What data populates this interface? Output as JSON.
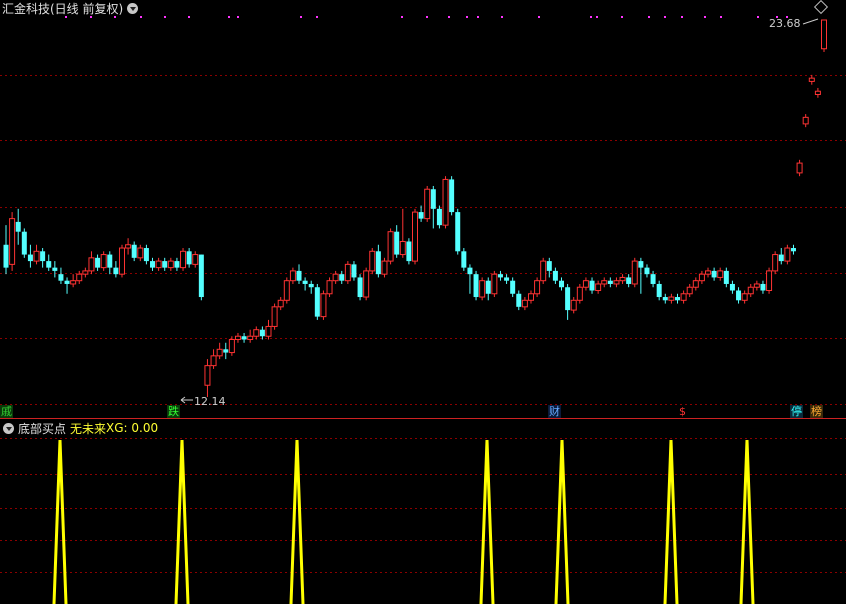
{
  "header": {
    "title": "汇金科技(日线 前复权)"
  },
  "price_labels": {
    "high": "23.68",
    "low": "12.14"
  },
  "markers": [
    {
      "text": "戚",
      "color": "#33cc33",
      "bg": "#0a3a0a"
    },
    {
      "text": "跌",
      "color": "#33ff33",
      "bg": "#0a3a0a"
    },
    {
      "text": "财",
      "color": "#66aaff",
      "bg": "#0a1a3a"
    },
    {
      "text": "$",
      "color": "#ff3333",
      "bg": "transparent"
    },
    {
      "text": "停",
      "color": "#33ffff",
      "bg": "#0a2a3a"
    },
    {
      "text": "榜",
      "color": "#ffaa33",
      "bg": "#3a2a0a"
    }
  ],
  "indicator": {
    "name": "底部买点",
    "param1": "无未来",
    "param2": "XG: 0.00"
  },
  "colors": {
    "up": "#ff3333",
    "down": "#54ffff",
    "grid": "#8b0000",
    "signal": "#ffff00",
    "dots": "#ff33ff"
  },
  "chart_data": {
    "type": "candlestick",
    "symbol": "汇金科技",
    "period": "日线 前复权",
    "ylim": [
      12.14,
      23.68
    ],
    "candles": [
      [
        16.8,
        16.1,
        17.4,
        15.9
      ],
      [
        16.2,
        17.6,
        17.8,
        16.0
      ],
      [
        17.5,
        17.2,
        17.9,
        16.8
      ],
      [
        17.2,
        16.5,
        17.3,
        16.4
      ],
      [
        16.5,
        16.3,
        16.8,
        16.1
      ],
      [
        16.3,
        16.6,
        16.8,
        16.2
      ],
      [
        16.6,
        16.3,
        16.7,
        16.1
      ],
      [
        16.3,
        16.1,
        16.5,
        16.0
      ],
      [
        16.1,
        16.0,
        16.3,
        15.8
      ],
      [
        15.9,
        15.7,
        16.1,
        15.6
      ],
      [
        15.7,
        15.6,
        15.8,
        15.3
      ],
      [
        15.6,
        15.7,
        15.9,
        15.5
      ],
      [
        15.7,
        15.9,
        16.0,
        15.6
      ],
      [
        15.9,
        16.0,
        16.1,
        15.8
      ],
      [
        16.0,
        16.4,
        16.6,
        15.9
      ],
      [
        16.4,
        16.1,
        16.5,
        16.0
      ],
      [
        16.1,
        16.5,
        16.6,
        16.0
      ],
      [
        16.5,
        16.1,
        16.6,
        15.9
      ],
      [
        16.1,
        15.9,
        16.3,
        15.8
      ],
      [
        15.9,
        16.7,
        16.8,
        15.8
      ],
      [
        16.7,
        16.8,
        17.0,
        16.5
      ],
      [
        16.8,
        16.4,
        16.9,
        16.3
      ],
      [
        16.4,
        16.7,
        16.8,
        16.3
      ],
      [
        16.7,
        16.3,
        16.8,
        16.2
      ],
      [
        16.3,
        16.1,
        16.4,
        16.0
      ],
      [
        16.1,
        16.3,
        16.4,
        16.0
      ],
      [
        16.3,
        16.1,
        16.4,
        16.0
      ],
      [
        16.1,
        16.3,
        16.4,
        16.0
      ],
      [
        16.3,
        16.1,
        16.4,
        16.0
      ],
      [
        16.1,
        16.6,
        16.7,
        16.0
      ],
      [
        16.6,
        16.2,
        16.7,
        16.1
      ],
      [
        16.2,
        16.5,
        16.6,
        16.1
      ],
      [
        16.5,
        15.2,
        16.5,
        15.1
      ],
      [
        12.5,
        13.1,
        13.3,
        12.14
      ],
      [
        13.1,
        13.4,
        13.6,
        13.0
      ],
      [
        13.4,
        13.6,
        13.8,
        13.3
      ],
      [
        13.6,
        13.5,
        13.8,
        13.3
      ],
      [
        13.5,
        13.9,
        14.0,
        13.4
      ],
      [
        13.9,
        14.0,
        14.1,
        13.8
      ],
      [
        14.0,
        13.9,
        14.1,
        13.8
      ],
      [
        13.9,
        14.0,
        14.2,
        13.8
      ],
      [
        14.0,
        14.2,
        14.3,
        13.9
      ],
      [
        14.2,
        14.0,
        14.3,
        13.9
      ],
      [
        14.0,
        14.3,
        14.5,
        13.9
      ],
      [
        14.3,
        14.9,
        15.0,
        14.2
      ],
      [
        14.9,
        15.1,
        15.2,
        14.8
      ],
      [
        15.1,
        15.7,
        15.8,
        15.0
      ],
      [
        15.7,
        16.0,
        16.1,
        15.6
      ],
      [
        16.0,
        15.7,
        16.2,
        15.6
      ],
      [
        15.7,
        15.6,
        15.8,
        15.4
      ],
      [
        15.6,
        15.5,
        15.7,
        15.3
      ],
      [
        15.5,
        14.6,
        15.6,
        14.5
      ],
      [
        14.6,
        15.3,
        15.4,
        14.5
      ],
      [
        15.3,
        15.7,
        15.8,
        15.2
      ],
      [
        15.7,
        15.9,
        16.0,
        15.6
      ],
      [
        15.9,
        15.7,
        16.0,
        15.6
      ],
      [
        15.7,
        16.2,
        16.3,
        15.6
      ],
      [
        16.2,
        15.8,
        16.3,
        15.7
      ],
      [
        15.8,
        15.2,
        15.9,
        15.1
      ],
      [
        15.2,
        16.0,
        16.1,
        15.1
      ],
      [
        16.0,
        16.6,
        16.7,
        15.9
      ],
      [
        16.6,
        15.9,
        16.8,
        15.8
      ],
      [
        15.9,
        16.3,
        16.4,
        15.8
      ],
      [
        16.3,
        17.2,
        17.3,
        16.2
      ],
      [
        17.2,
        16.5,
        17.4,
        16.4
      ],
      [
        16.5,
        16.9,
        17.9,
        16.4
      ],
      [
        16.9,
        16.3,
        17.0,
        16.2
      ],
      [
        16.3,
        17.8,
        17.9,
        16.2
      ],
      [
        17.8,
        17.6,
        18.0,
        17.5
      ],
      [
        17.6,
        18.5,
        18.6,
        17.5
      ],
      [
        18.5,
        17.9,
        18.6,
        17.3
      ],
      [
        17.9,
        17.4,
        18.0,
        17.3
      ],
      [
        17.4,
        18.8,
        18.9,
        17.3
      ],
      [
        18.8,
        17.8,
        18.9,
        17.7
      ],
      [
        17.8,
        16.6,
        17.9,
        16.5
      ],
      [
        16.6,
        16.1,
        16.7,
        16.0
      ],
      [
        16.1,
        15.9,
        16.2,
        15.3
      ],
      [
        15.9,
        15.2,
        16.0,
        15.1
      ],
      [
        15.2,
        15.7,
        15.8,
        15.1
      ],
      [
        15.7,
        15.3,
        15.8,
        15.1
      ],
      [
        15.3,
        15.9,
        16.0,
        15.2
      ],
      [
        15.9,
        15.8,
        16.0,
        15.7
      ],
      [
        15.8,
        15.7,
        15.9,
        15.6
      ],
      [
        15.7,
        15.3,
        15.8,
        15.2
      ],
      [
        15.3,
        14.9,
        15.4,
        14.8
      ],
      [
        14.9,
        15.1,
        15.2,
        14.8
      ],
      [
        15.1,
        15.3,
        15.4,
        15.0
      ],
      [
        15.3,
        15.7,
        15.8,
        15.2
      ],
      [
        15.7,
        16.3,
        16.4,
        15.6
      ],
      [
        16.3,
        16.0,
        16.4,
        15.8
      ],
      [
        16.0,
        15.7,
        16.1,
        15.6
      ],
      [
        15.7,
        15.5,
        15.8,
        15.4
      ],
      [
        15.5,
        14.8,
        15.6,
        14.5
      ],
      [
        14.8,
        15.1,
        15.2,
        14.7
      ],
      [
        15.1,
        15.5,
        15.6,
        15.0
      ],
      [
        15.5,
        15.7,
        15.8,
        15.4
      ],
      [
        15.7,
        15.4,
        15.8,
        15.3
      ],
      [
        15.4,
        15.6,
        15.7,
        15.3
      ],
      [
        15.6,
        15.7,
        15.8,
        15.5
      ],
      [
        15.7,
        15.6,
        15.8,
        15.5
      ],
      [
        15.6,
        15.7,
        15.8,
        15.5
      ],
      [
        15.7,
        15.8,
        15.9,
        15.6
      ],
      [
        15.8,
        15.6,
        15.9,
        15.5
      ],
      [
        15.6,
        16.3,
        16.4,
        15.5
      ],
      [
        16.3,
        16.1,
        16.4,
        15.3
      ],
      [
        16.1,
        15.9,
        16.2,
        15.8
      ],
      [
        15.9,
        15.6,
        16.0,
        15.5
      ],
      [
        15.6,
        15.2,
        15.7,
        15.1
      ],
      [
        15.2,
        15.1,
        15.3,
        15.0
      ],
      [
        15.1,
        15.2,
        15.3,
        15.0
      ],
      [
        15.2,
        15.1,
        15.3,
        15.0
      ],
      [
        15.1,
        15.3,
        15.4,
        15.0
      ],
      [
        15.3,
        15.5,
        15.6,
        15.2
      ],
      [
        15.5,
        15.7,
        15.8,
        15.4
      ],
      [
        15.7,
        15.9,
        16.0,
        15.6
      ],
      [
        15.9,
        16.0,
        16.1,
        15.8
      ],
      [
        16.0,
        15.8,
        16.1,
        15.7
      ],
      [
        15.8,
        16.0,
        16.1,
        15.7
      ],
      [
        16.0,
        15.6,
        16.1,
        15.5
      ],
      [
        15.6,
        15.4,
        15.7,
        15.3
      ],
      [
        15.4,
        15.1,
        15.5,
        15.0
      ],
      [
        15.1,
        15.3,
        15.4,
        15.0
      ],
      [
        15.3,
        15.5,
        15.6,
        15.2
      ],
      [
        15.5,
        15.6,
        15.7,
        15.4
      ],
      [
        15.6,
        15.4,
        15.7,
        15.3
      ],
      [
        15.4,
        16.0,
        16.1,
        15.3
      ],
      [
        16.0,
        16.5,
        16.6,
        15.9
      ],
      [
        16.5,
        16.3,
        16.7,
        16.2
      ],
      [
        16.3,
        16.7,
        16.8,
        16.2
      ],
      [
        16.7,
        16.6,
        16.8,
        16.5
      ],
      [
        19.0,
        19.3,
        19.4,
        18.9
      ],
      [
        20.5,
        20.7,
        20.8,
        20.4
      ],
      [
        21.8,
        21.9,
        22.0,
        21.7
      ],
      [
        21.4,
        21.5,
        21.6,
        21.3
      ],
      [
        22.8,
        23.68,
        23.68,
        22.7
      ]
    ],
    "signals_count": 7
  }
}
